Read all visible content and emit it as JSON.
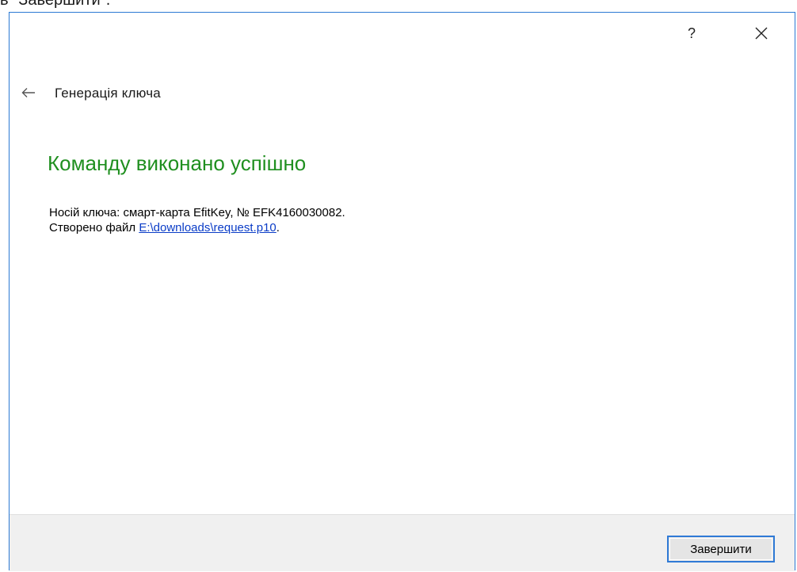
{
  "background_snippet": "в \"Завершити\".",
  "dialog": {
    "help_label": "?",
    "header_title": "Генерація  ключа",
    "success_message": "Команду виконано успішно",
    "info_line1": "Носій ключа: смарт-карта EfitKey, № EFK4160030082.",
    "info_line2_prefix": "Створено файл ",
    "file_link": "E:\\downloads\\request.p10",
    "info_line2_suffix": ".",
    "finish_button": "Завершити"
  },
  "colors": {
    "success_green": "#1f8f1f",
    "link_blue": "#0a3cc7",
    "accent_blue": "#2f7ad6",
    "footer_bg": "#f0f0f0"
  },
  "icons": {
    "close": "close-icon",
    "back": "back-arrow-icon"
  }
}
